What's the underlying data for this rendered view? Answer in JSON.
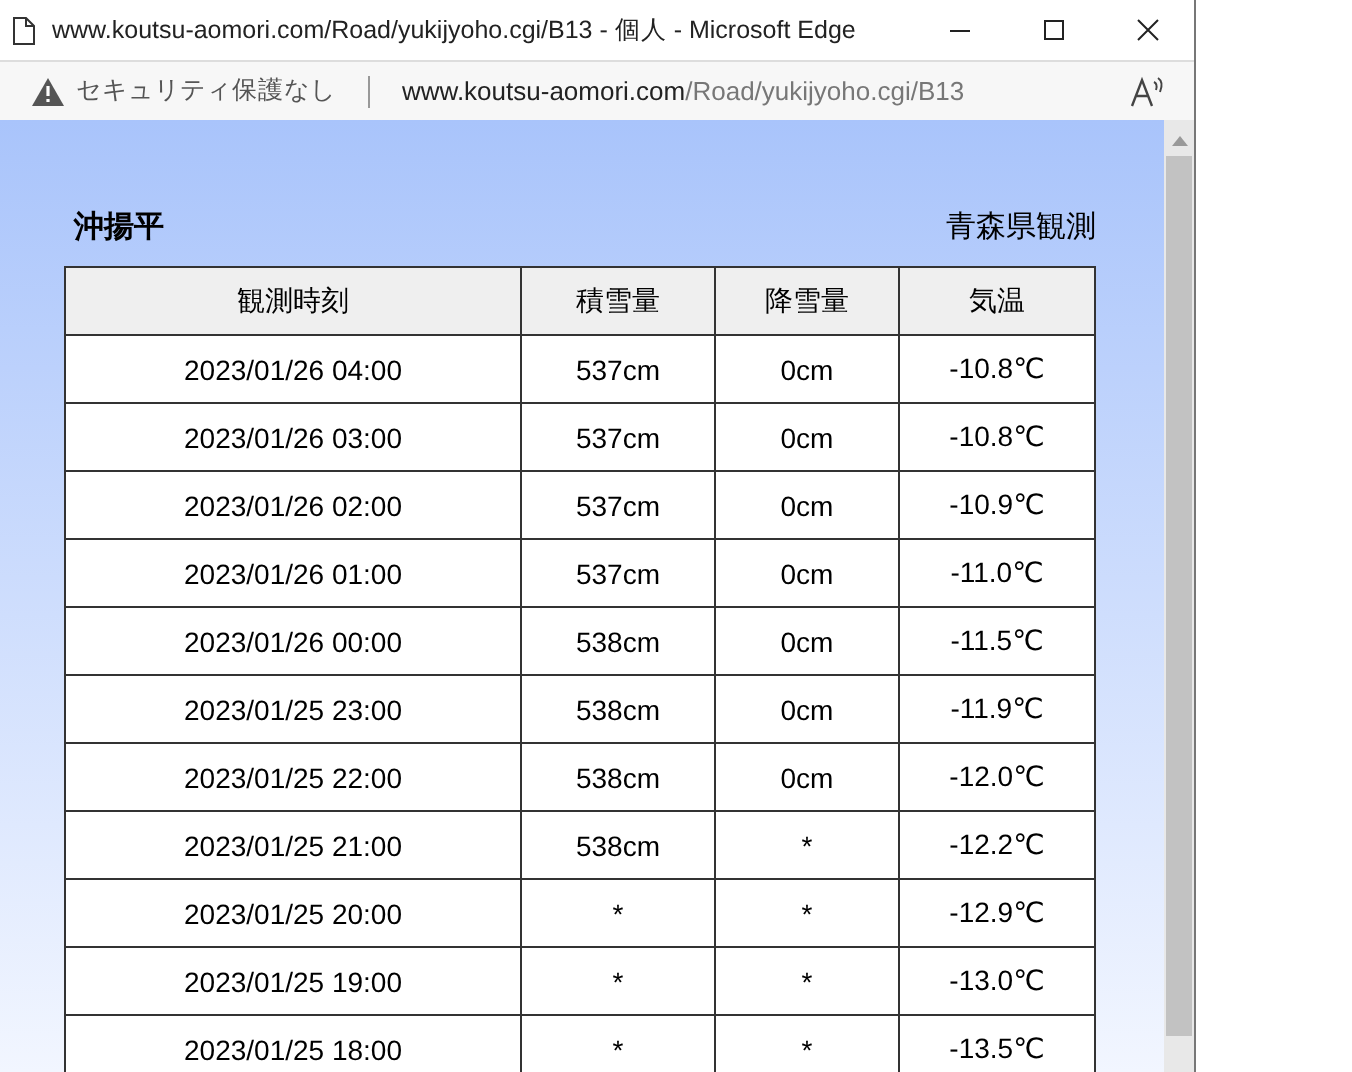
{
  "window": {
    "title": "www.koutsu-aomori.com/Road/yukijyoho.cgi/B13 - 個人 - Microsoft Edge"
  },
  "address_bar": {
    "security": "セキュリティ保護なし",
    "host": "www.koutsu-aomori.com",
    "path": "/Road/yukijyoho.cgi/B13"
  },
  "page": {
    "station": "沖揚平",
    "source": "青森県観測"
  },
  "table": {
    "columns": [
      "観測時刻",
      "積雪量",
      "降雪量",
      "気温"
    ],
    "rows": [
      [
        "2023/01/26 04:00",
        "537cm",
        "0cm",
        "-10.8℃"
      ],
      [
        "2023/01/26 03:00",
        "537cm",
        "0cm",
        "-10.8℃"
      ],
      [
        "2023/01/26 02:00",
        "537cm",
        "0cm",
        "-10.9℃"
      ],
      [
        "2023/01/26 01:00",
        "537cm",
        "0cm",
        "-11.0℃"
      ],
      [
        "2023/01/26 00:00",
        "538cm",
        "0cm",
        "-11.5℃"
      ],
      [
        "2023/01/25 23:00",
        "538cm",
        "0cm",
        "-11.9℃"
      ],
      [
        "2023/01/25 22:00",
        "538cm",
        "0cm",
        "-12.0℃"
      ],
      [
        "2023/01/25 21:00",
        "538cm",
        "*",
        "-12.2℃"
      ],
      [
        "2023/01/25 20:00",
        "*",
        "*",
        "-12.9℃"
      ],
      [
        "2023/01/25 19:00",
        "*",
        "*",
        "-13.0℃"
      ],
      [
        "2023/01/25 18:00",
        "*",
        "*",
        "-13.5℃"
      ]
    ]
  }
}
